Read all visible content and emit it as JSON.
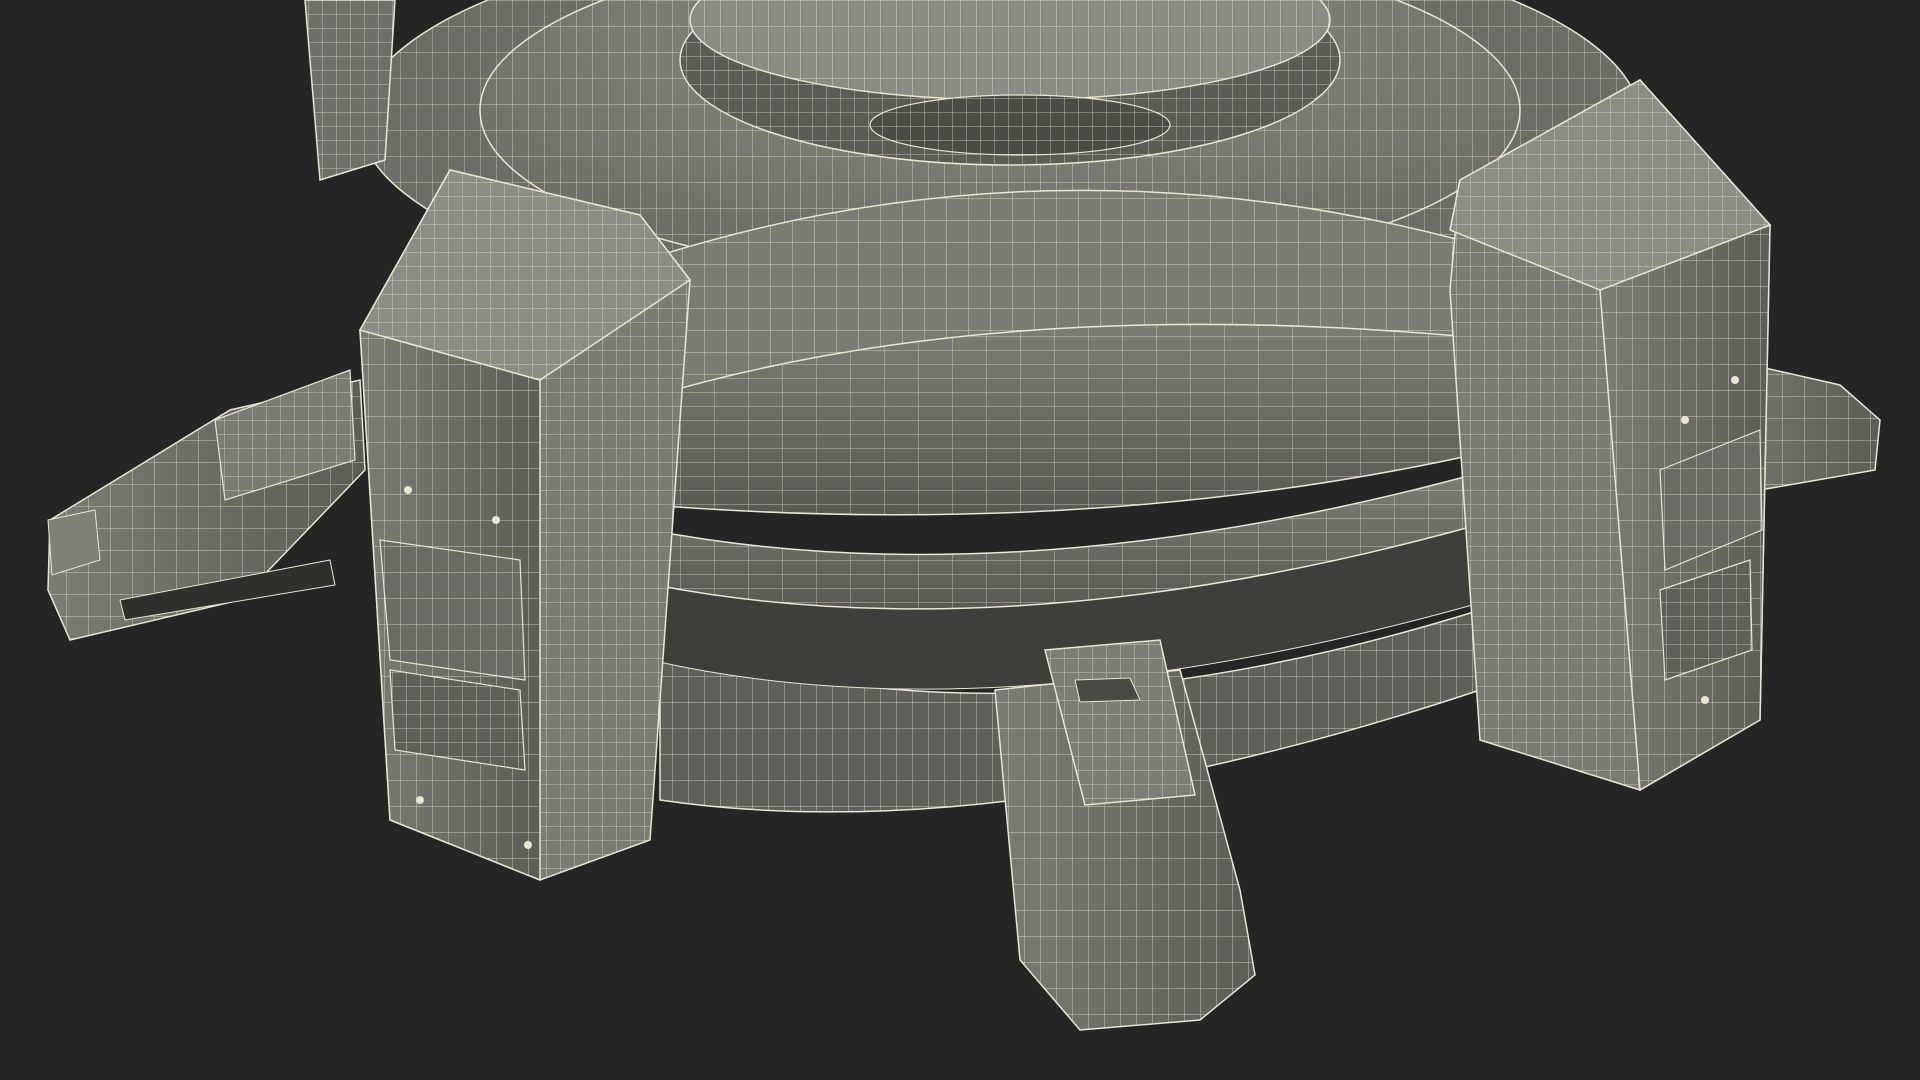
{
  "scene": {
    "subject": "wireframe-render",
    "colors": {
      "background": "#252525",
      "surface": "#6f7068",
      "surface_light": "#878880",
      "surface_dark": "#55564f",
      "shadow": "#3e3f3a",
      "wire": "#e8e6d2"
    }
  }
}
